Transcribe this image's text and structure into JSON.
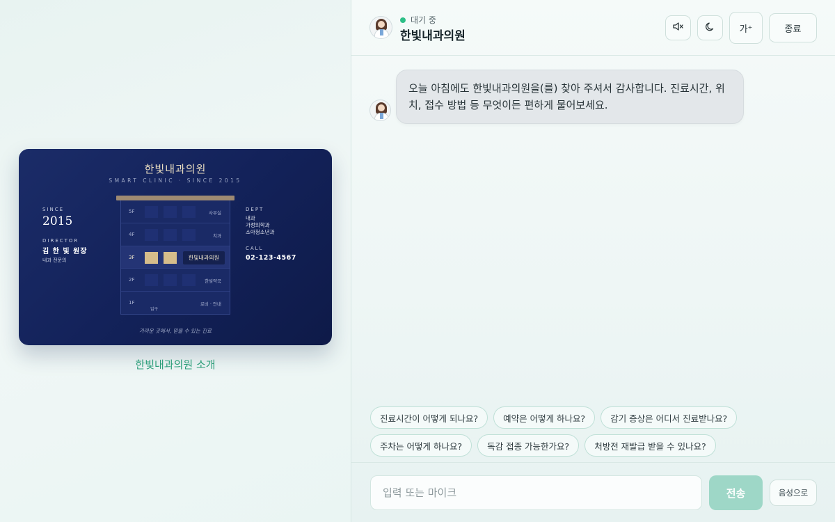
{
  "card": {
    "title": "한빛내과의원",
    "subtitle": "SMART CLINIC · SINCE 2015",
    "since_label": "SINCE",
    "since_value": "2015",
    "director_label": "DIRECTOR",
    "director_name": "김 한 빛 원장",
    "director_sub": "내과 전문의",
    "dept_label": "DEPT",
    "dept_items": [
      "내과",
      "가정의학과",
      "소아청소년과"
    ],
    "call_label": "CALL",
    "call_value": "02-123-4567",
    "floors": [
      {
        "num": "5F",
        "tag": "사무실"
      },
      {
        "num": "4F",
        "tag": "치과"
      },
      {
        "num": "3F",
        "tag": "한빛내과의원"
      },
      {
        "num": "2F",
        "tag": "한빛약국"
      },
      {
        "num": "1F",
        "tag": "로비 · 안내",
        "entry": "입구"
      }
    ],
    "motto": "가까운 곳에서, 믿을 수 있는 진료",
    "caption": "한빛내과의원 소개"
  },
  "header": {
    "status": "대기 중",
    "status_color": "#2dbf87",
    "clinic_name": "한빛내과의원",
    "mute_icon": "speaker-mute-icon",
    "theme_icon": "moon-icon",
    "font_size_label": "가⁺",
    "end_label": "종료"
  },
  "chat": {
    "greeting": "오늘 아침에도 한빛내과의원을(를) 찾아 주셔서 감사합니다. 진료시간, 위치, 접수 방법 등 무엇이든 편하게 물어보세요."
  },
  "suggestions": [
    "진료시간이 어떻게 되나요?",
    "예약은 어떻게 하나요?",
    "감기 증상은 어디서 진료받나요?",
    "주차는 어떻게 하나요?",
    "독감 접종 가능한가요?",
    "처방전 재발급 받을 수 있나요?"
  ],
  "input": {
    "placeholder": "입력 또는 마이크",
    "value": "",
    "send_label": "전송",
    "voice_label": "음성으로"
  },
  "colors": {
    "accent": "#2a9d78",
    "send_button": "#9ed7c7",
    "card_navy": "#13225a",
    "window_lit": "#d6bd8b"
  }
}
